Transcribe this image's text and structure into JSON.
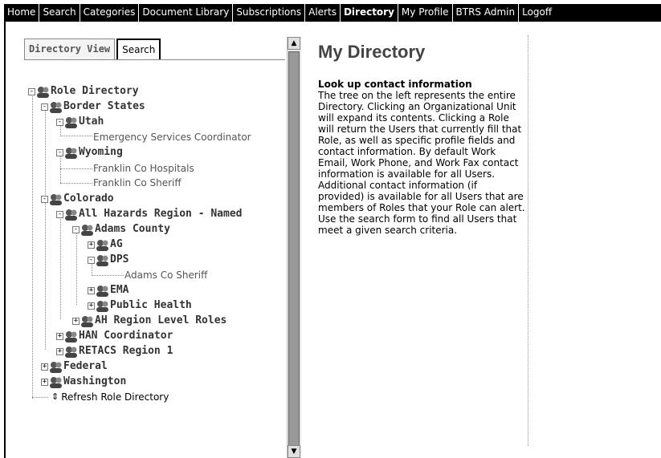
{
  "nav": {
    "tabs": [
      "Home",
      "Search",
      "Categories",
      "Document Library",
      "Subscriptions",
      "Alerts",
      "Directory",
      "My Profile",
      "BTRS Admin",
      "Logoff"
    ],
    "active": "Directory"
  },
  "view_tabs": {
    "directory_view": "Directory View",
    "search": "Search"
  },
  "tree": {
    "root": "Role Directory",
    "border_states": "Border States",
    "utah": "Utah",
    "esc": "Emergency Services Coordinator",
    "wyoming": "Wyoming",
    "franklin_hosp": "Franklin Co Hospitals",
    "franklin_sheriff": "Franklin Co Sheriff",
    "colorado": "Colorado",
    "ahr": "All Hazards Region - Named",
    "adams": "Adams County",
    "ag": "AG",
    "dps": "DPS",
    "adams_sheriff": "Adams Co Sheriff",
    "ema": "EMA",
    "public_health": "Public Health",
    "ah_roles": "AH Region Level Roles",
    "han": "HAN Coordinator",
    "retacs": "RETACS Region 1",
    "federal": "Federal",
    "washington": "Washington",
    "refresh": "Refresh Role Directory",
    "refresh_icon": "⇕",
    "expanded_glyph": "-",
    "collapsed_glyph": "+"
  },
  "content": {
    "title": "My Directory",
    "heading": "Look up contact information",
    "body": "The tree on the left represents the entire Directory. Clicking an Organizational Unit will expand its contents. Clicking a Role will return the Users that currently fill that Role, as well as specific profile fields and contact information. By default Work Email, Work Phone, and Work Fax contact information is available for all Users. Additional contact information (if provided) is available for all Users that are members of Roles that your Role can alert. Use the search form to find all Users that meet a given search criteria."
  },
  "scrollbar": {
    "up": "▲",
    "down": "▼"
  }
}
